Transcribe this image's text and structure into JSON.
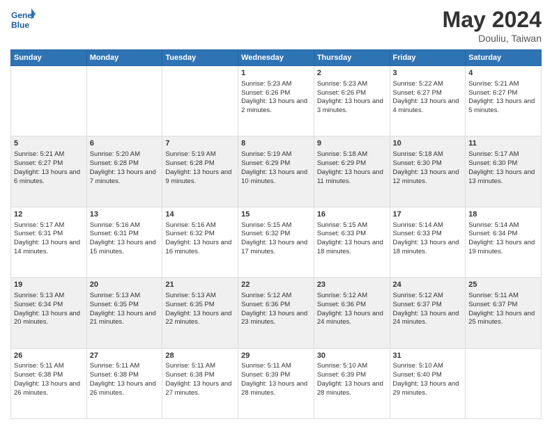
{
  "header": {
    "logo_line1": "General",
    "logo_line2": "Blue",
    "month_year": "May 2024",
    "location": "Douliu, Taiwan"
  },
  "weekdays": [
    "Sunday",
    "Monday",
    "Tuesday",
    "Wednesday",
    "Thursday",
    "Friday",
    "Saturday"
  ],
  "weeks": [
    [
      {
        "day": "",
        "sunrise": "",
        "sunset": "",
        "daylight": ""
      },
      {
        "day": "",
        "sunrise": "",
        "sunset": "",
        "daylight": ""
      },
      {
        "day": "",
        "sunrise": "",
        "sunset": "",
        "daylight": ""
      },
      {
        "day": "1",
        "sunrise": "Sunrise: 5:23 AM",
        "sunset": "Sunset: 6:26 PM",
        "daylight": "Daylight: 13 hours and 2 minutes."
      },
      {
        "day": "2",
        "sunrise": "Sunrise: 5:23 AM",
        "sunset": "Sunset: 6:26 PM",
        "daylight": "Daylight: 13 hours and 3 minutes."
      },
      {
        "day": "3",
        "sunrise": "Sunrise: 5:22 AM",
        "sunset": "Sunset: 6:27 PM",
        "daylight": "Daylight: 13 hours and 4 minutes."
      },
      {
        "day": "4",
        "sunrise": "Sunrise: 5:21 AM",
        "sunset": "Sunset: 6:27 PM",
        "daylight": "Daylight: 13 hours and 5 minutes."
      }
    ],
    [
      {
        "day": "5",
        "sunrise": "Sunrise: 5:21 AM",
        "sunset": "Sunset: 6:27 PM",
        "daylight": "Daylight: 13 hours and 6 minutes."
      },
      {
        "day": "6",
        "sunrise": "Sunrise: 5:20 AM",
        "sunset": "Sunset: 6:28 PM",
        "daylight": "Daylight: 13 hours and 7 minutes."
      },
      {
        "day": "7",
        "sunrise": "Sunrise: 5:19 AM",
        "sunset": "Sunset: 6:28 PM",
        "daylight": "Daylight: 13 hours and 9 minutes."
      },
      {
        "day": "8",
        "sunrise": "Sunrise: 5:19 AM",
        "sunset": "Sunset: 6:29 PM",
        "daylight": "Daylight: 13 hours and 10 minutes."
      },
      {
        "day": "9",
        "sunrise": "Sunrise: 5:18 AM",
        "sunset": "Sunset: 6:29 PM",
        "daylight": "Daylight: 13 hours and 11 minutes."
      },
      {
        "day": "10",
        "sunrise": "Sunrise: 5:18 AM",
        "sunset": "Sunset: 6:30 PM",
        "daylight": "Daylight: 13 hours and 12 minutes."
      },
      {
        "day": "11",
        "sunrise": "Sunrise: 5:17 AM",
        "sunset": "Sunset: 6:30 PM",
        "daylight": "Daylight: 13 hours and 13 minutes."
      }
    ],
    [
      {
        "day": "12",
        "sunrise": "Sunrise: 5:17 AM",
        "sunset": "Sunset: 6:31 PM",
        "daylight": "Daylight: 13 hours and 14 minutes."
      },
      {
        "day": "13",
        "sunrise": "Sunrise: 5:16 AM",
        "sunset": "Sunset: 6:31 PM",
        "daylight": "Daylight: 13 hours and 15 minutes."
      },
      {
        "day": "14",
        "sunrise": "Sunrise: 5:16 AM",
        "sunset": "Sunset: 6:32 PM",
        "daylight": "Daylight: 13 hours and 16 minutes."
      },
      {
        "day": "15",
        "sunrise": "Sunrise: 5:15 AM",
        "sunset": "Sunset: 6:32 PM",
        "daylight": "Daylight: 13 hours and 17 minutes."
      },
      {
        "day": "16",
        "sunrise": "Sunrise: 5:15 AM",
        "sunset": "Sunset: 6:33 PM",
        "daylight": "Daylight: 13 hours and 18 minutes."
      },
      {
        "day": "17",
        "sunrise": "Sunrise: 5:14 AM",
        "sunset": "Sunset: 6:33 PM",
        "daylight": "Daylight: 13 hours and 18 minutes."
      },
      {
        "day": "18",
        "sunrise": "Sunrise: 5:14 AM",
        "sunset": "Sunset: 6:34 PM",
        "daylight": "Daylight: 13 hours and 19 minutes."
      }
    ],
    [
      {
        "day": "19",
        "sunrise": "Sunrise: 5:13 AM",
        "sunset": "Sunset: 6:34 PM",
        "daylight": "Daylight: 13 hours and 20 minutes."
      },
      {
        "day": "20",
        "sunrise": "Sunrise: 5:13 AM",
        "sunset": "Sunset: 6:35 PM",
        "daylight": "Daylight: 13 hours and 21 minutes."
      },
      {
        "day": "21",
        "sunrise": "Sunrise: 5:13 AM",
        "sunset": "Sunset: 6:35 PM",
        "daylight": "Daylight: 13 hours and 22 minutes."
      },
      {
        "day": "22",
        "sunrise": "Sunrise: 5:12 AM",
        "sunset": "Sunset: 6:36 PM",
        "daylight": "Daylight: 13 hours and 23 minutes."
      },
      {
        "day": "23",
        "sunrise": "Sunrise: 5:12 AM",
        "sunset": "Sunset: 6:36 PM",
        "daylight": "Daylight: 13 hours and 24 minutes."
      },
      {
        "day": "24",
        "sunrise": "Sunrise: 5:12 AM",
        "sunset": "Sunset: 6:37 PM",
        "daylight": "Daylight: 13 hours and 24 minutes."
      },
      {
        "day": "25",
        "sunrise": "Sunrise: 5:11 AM",
        "sunset": "Sunset: 6:37 PM",
        "daylight": "Daylight: 13 hours and 25 minutes."
      }
    ],
    [
      {
        "day": "26",
        "sunrise": "Sunrise: 5:11 AM",
        "sunset": "Sunset: 6:38 PM",
        "daylight": "Daylight: 13 hours and 26 minutes."
      },
      {
        "day": "27",
        "sunrise": "Sunrise: 5:11 AM",
        "sunset": "Sunset: 6:38 PM",
        "daylight": "Daylight: 13 hours and 26 minutes."
      },
      {
        "day": "28",
        "sunrise": "Sunrise: 5:11 AM",
        "sunset": "Sunset: 6:38 PM",
        "daylight": "Daylight: 13 hours and 27 minutes."
      },
      {
        "day": "29",
        "sunrise": "Sunrise: 5:11 AM",
        "sunset": "Sunset: 6:39 PM",
        "daylight": "Daylight: 13 hours and 28 minutes."
      },
      {
        "day": "30",
        "sunrise": "Sunrise: 5:10 AM",
        "sunset": "Sunset: 6:39 PM",
        "daylight": "Daylight: 13 hours and 28 minutes."
      },
      {
        "day": "31",
        "sunrise": "Sunrise: 5:10 AM",
        "sunset": "Sunset: 6:40 PM",
        "daylight": "Daylight: 13 hours and 29 minutes."
      },
      {
        "day": "",
        "sunrise": "",
        "sunset": "",
        "daylight": ""
      }
    ]
  ]
}
